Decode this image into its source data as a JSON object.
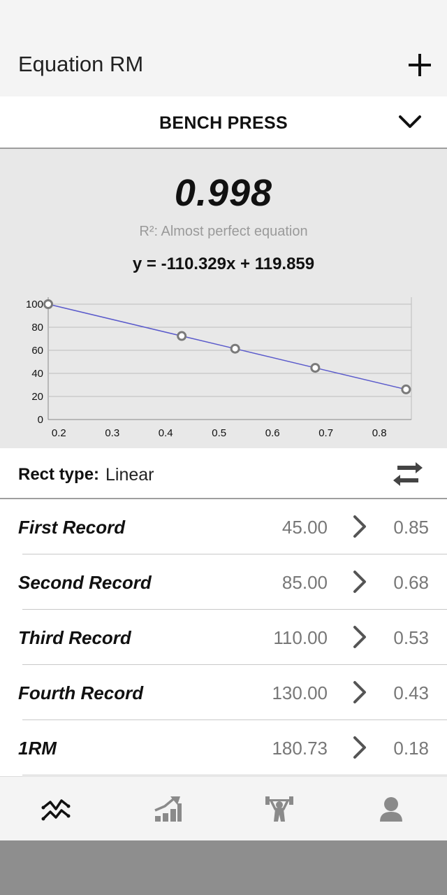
{
  "appbar": {
    "title": "Equation RM",
    "add_icon": "plus-icon"
  },
  "exercise": {
    "selected": "BENCH PRESS",
    "dropdown_icon": "chevron-down-icon"
  },
  "summary": {
    "r2_value": "0.998",
    "r2_description": "R²: Almost perfect equation",
    "equation": "y = -110.329x + 119.859"
  },
  "chart_data": {
    "type": "line",
    "x": [
      0.18,
      0.43,
      0.53,
      0.68,
      0.85
    ],
    "y": [
      100,
      72.4,
      61.4,
      44.8,
      26.1
    ],
    "xlim": [
      0.18,
      0.86
    ],
    "ylim": [
      0,
      100
    ],
    "x_ticks": [
      "0.2",
      "0.3",
      "0.4",
      "0.5",
      "0.6",
      "0.7",
      "0.8"
    ],
    "x_tick_values": [
      0.2,
      0.3,
      0.4,
      0.5,
      0.6,
      0.7,
      0.8
    ],
    "y_ticks": [
      "0",
      "20",
      "40",
      "60",
      "80",
      "100"
    ],
    "y_tick_values": [
      0,
      20,
      40,
      60,
      80,
      100
    ],
    "grid": true,
    "line_color": "#5a5acb",
    "marker_color": "#7a7a7a"
  },
  "rect_type": {
    "label": "Rect type:",
    "value": "Linear",
    "swap_icon": "swap-arrows-icon"
  },
  "records": [
    {
      "name": "First Record",
      "weight": "45.00",
      "value": "0.85"
    },
    {
      "name": "Second Record",
      "weight": "85.00",
      "value": "0.68"
    },
    {
      "name": "Third Record",
      "weight": "110.00",
      "value": "0.53"
    },
    {
      "name": "Fourth Record",
      "weight": "130.00",
      "value": "0.43"
    },
    {
      "name": "1RM",
      "weight": "180.73",
      "value": "0.18"
    }
  ],
  "nav": {
    "items": [
      "line-chart-icon",
      "progress-chart-icon",
      "weightlifter-icon",
      "profile-icon"
    ],
    "active": "line-chart-icon"
  }
}
